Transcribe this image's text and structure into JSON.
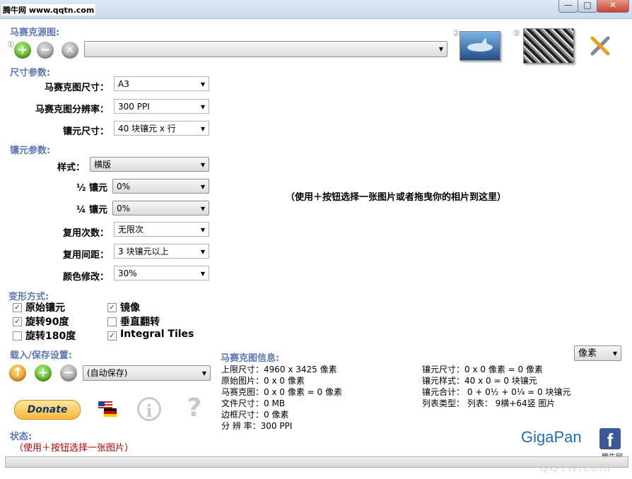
{
  "window": {
    "watermark": "腾牛网 www.qqtn.com",
    "min_label": "—",
    "max_label": "□",
    "close_label": "✕"
  },
  "source": {
    "title": "马赛克源图:",
    "path_value": "",
    "add_icon": "plus-icon",
    "remove_icon": "minus-icon",
    "clear_icon": "x-icon",
    "step_markers": [
      "①",
      "②",
      "③"
    ]
  },
  "size": {
    "title": "尺寸参数:",
    "rows": [
      {
        "label": "马赛克图尺寸：",
        "value": "A3"
      },
      {
        "label": "马赛克图分辨率：",
        "value": "300 PPI"
      },
      {
        "label": "镶元尺寸：",
        "value": "40 块镶元 x 行"
      }
    ]
  },
  "tile": {
    "title": "镶元参数:",
    "rows": [
      {
        "label": "样式：",
        "value": "横版"
      },
      {
        "label": "½ 镶元",
        "value": "0%"
      },
      {
        "label": "¼ 镶元",
        "value": "0%"
      },
      {
        "label": "复用次数：",
        "value": "无限次"
      },
      {
        "label": "复用间距：",
        "value": "3 块镶元以上"
      },
      {
        "label": "颜色修改：",
        "value": "30%"
      }
    ]
  },
  "transform": {
    "title": "变形方式:",
    "options": [
      {
        "label": "原始镶元",
        "checked": "✓"
      },
      {
        "label": "镜像",
        "checked": "✓"
      },
      {
        "label": "旋转90度",
        "checked": "✓"
      },
      {
        "label": "垂直翻转",
        "checked": ""
      },
      {
        "label": "旋转180度",
        "checked": ""
      },
      {
        "label": "Integral Tiles",
        "checked": "✓"
      }
    ]
  },
  "save": {
    "title": "载入/保存设置:",
    "value": "(自动保存)"
  },
  "buttons": {
    "donate": "Donate",
    "info": "i",
    "help": "?"
  },
  "drop_message": "（使用＋按钮选择一张图片或者拖曳你的相片到这里）",
  "unit_select": "像素",
  "mosaic_info": {
    "title": "马赛克图信息:",
    "left": [
      "上限尺寸：4960 x 3425 像素",
      "原始图片：0 x 0 像素",
      "马赛克图：0 x 0 像素 = 0 像素",
      "文件尺寸：0 MB",
      "边框尺寸：0 像素",
      "分 辨 率：300 PPI"
    ],
    "right": [
      "镶元尺寸：0 x 0 像素 = 0 像素",
      "镶元样式：40 x 0 = 0 块镶元",
      "镶元合计：  0 + 0½ + 0¼ = 0 块镶元",
      "列表类型：  列表：  9横+64竖  图片"
    ]
  },
  "status": {
    "title": "状态:",
    "text": "（使用＋按钮选择一张图片）"
  },
  "brand": {
    "gigapan": "GigaPan",
    "facebook": "f",
    "watermark_top": "腾牛网",
    "watermark_bottom": "QQTN.com"
  },
  "colors": {
    "section": "#5e77b4",
    "status": "#b30000",
    "gigapan": "#1e6eb6"
  }
}
